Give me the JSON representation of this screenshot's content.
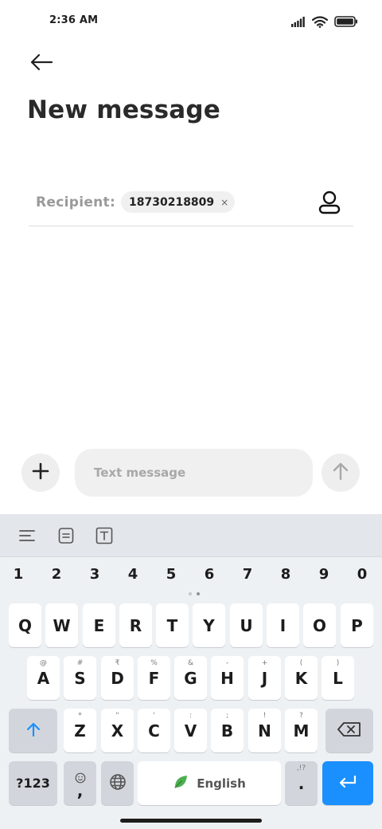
{
  "status_bar": {
    "time": "2:36 AM",
    "icons": [
      "signal-icon",
      "wifi-icon",
      "battery-icon"
    ]
  },
  "header": {
    "title": "New message",
    "back_icon": "back-arrow-icon"
  },
  "recipient": {
    "label": "Recipient:",
    "chip": "18730218809",
    "chip_close": "×",
    "contact_icon": "contact-icon"
  },
  "compose": {
    "attach_icon": "plus-icon",
    "placeholder": "Text message",
    "send_icon": "send-arrow-icon"
  },
  "keyboard": {
    "toolbar": [
      "menu-icon",
      "clipboard-icon",
      "text-format-icon"
    ],
    "numbers": [
      "1",
      "2",
      "3",
      "4",
      "5",
      "6",
      "7",
      "8",
      "9",
      "0"
    ],
    "row1": [
      "Q",
      "W",
      "E",
      "R",
      "T",
      "Y",
      "U",
      "I",
      "O",
      "P"
    ],
    "row2": [
      "A",
      "S",
      "D",
      "F",
      "G",
      "H",
      "J",
      "K",
      "L"
    ],
    "row2_hints": [
      "@",
      "#",
      "₹",
      "%",
      "&",
      "-",
      "+",
      "(",
      ")"
    ],
    "row3": [
      "Z",
      "X",
      "C",
      "V",
      "B",
      "N",
      "M"
    ],
    "row3_hints": [
      "*",
      "\"",
      "'",
      ":",
      ";",
      "!",
      "?"
    ],
    "symbols_key": "?123",
    "comma_key": ",",
    "space_label": "English",
    "period_key": ".",
    "period_hint": ",!?",
    "colors": {
      "accent": "#1a90ff",
      "leaf": "#4caf50"
    }
  }
}
